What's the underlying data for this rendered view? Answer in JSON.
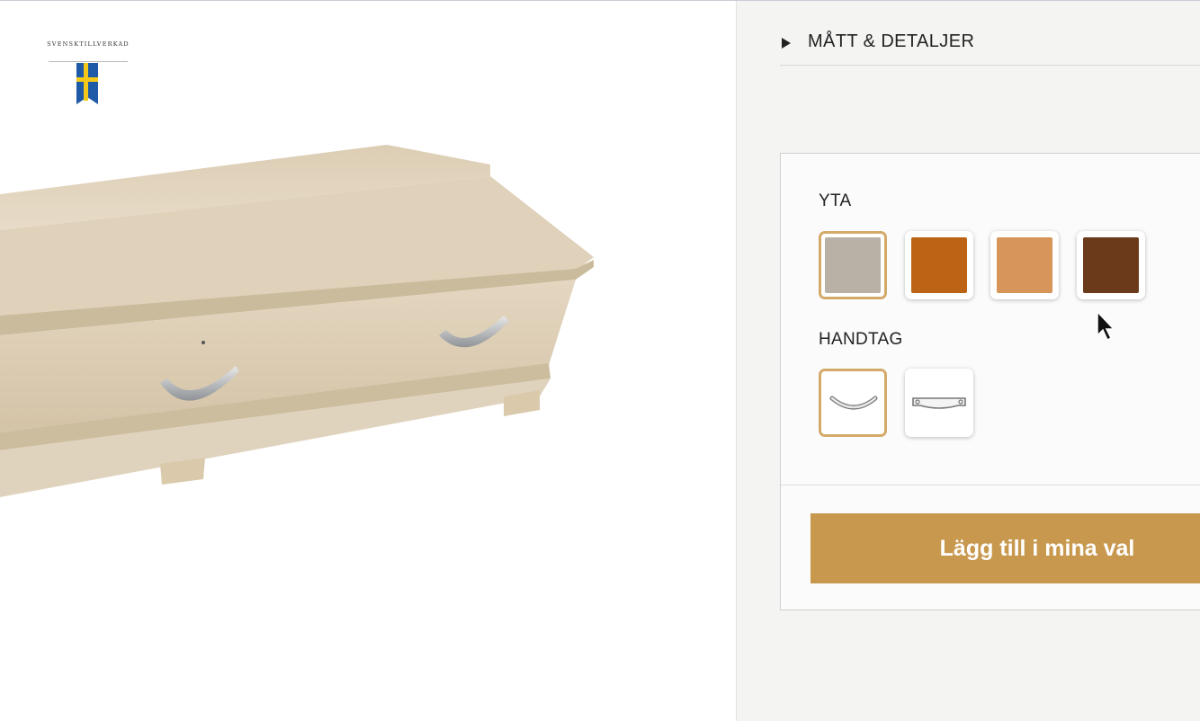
{
  "logo": {
    "text": "SVENSKTILLVERKAD"
  },
  "details": {
    "title": "MÅTT & DETALJER"
  },
  "options": {
    "surface": {
      "label": "YTA",
      "swatches": [
        {
          "name": "light oak",
          "color": "#b9b1a5",
          "selected": true
        },
        {
          "name": "cherry orange",
          "color": "#bc6316",
          "selected": false
        },
        {
          "name": "light cherry",
          "color": "#d7955a",
          "selected": false
        },
        {
          "name": "dark walnut",
          "color": "#6b3a1a",
          "selected": false
        }
      ]
    },
    "handle": {
      "label": "HANDTAG",
      "items": [
        {
          "name": "curved-handle",
          "selected": true
        },
        {
          "name": "bar-handle",
          "selected": false
        }
      ]
    }
  },
  "cta": {
    "label": "Lägg till i mina val"
  },
  "colors": {
    "accent": "#c8984f",
    "selected_border": "#d4aa6a"
  }
}
